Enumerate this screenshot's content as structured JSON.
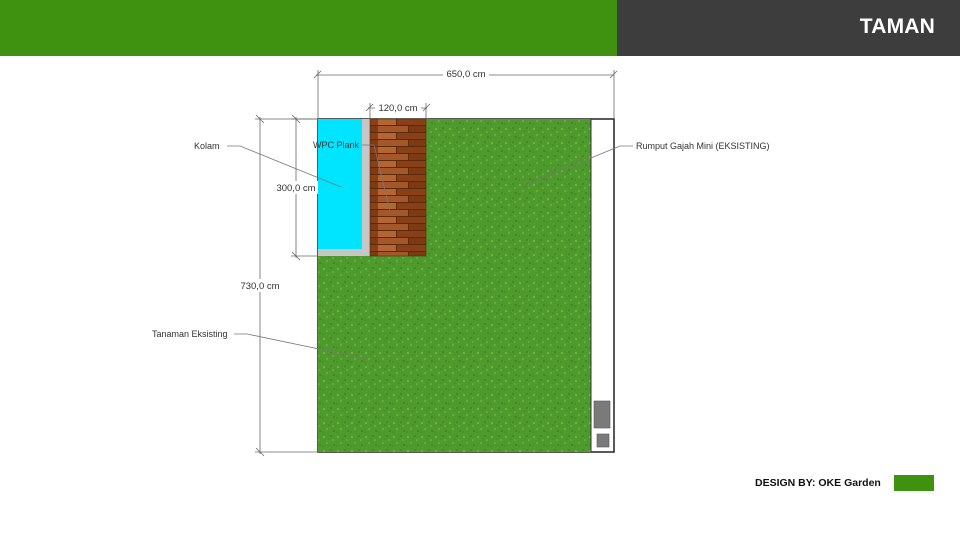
{
  "header": {
    "title": "TAMAN",
    "accent_color": "#3f920f",
    "dark_color": "#3d3d3d"
  },
  "plan": {
    "dimensions": {
      "total_width": "650,0 cm",
      "total_length": "730,0 cm",
      "deck_width": "120,0 cm",
      "pond_length": "300,0 cm"
    },
    "labels": {
      "pond": "Kolam",
      "deck": "WPC Plank",
      "grass": "Rumput Gajah Mini (EKSISTING)",
      "plants": "Tanaman Eksisting"
    },
    "colors": {
      "grass": "#4e9a2c",
      "pond": "#00e5ff",
      "deck": "#9a4b1e",
      "outline": "#222222"
    }
  },
  "footer": {
    "credit": "DESIGN BY: OKE Garden",
    "swatch_color": "#3f920f"
  }
}
